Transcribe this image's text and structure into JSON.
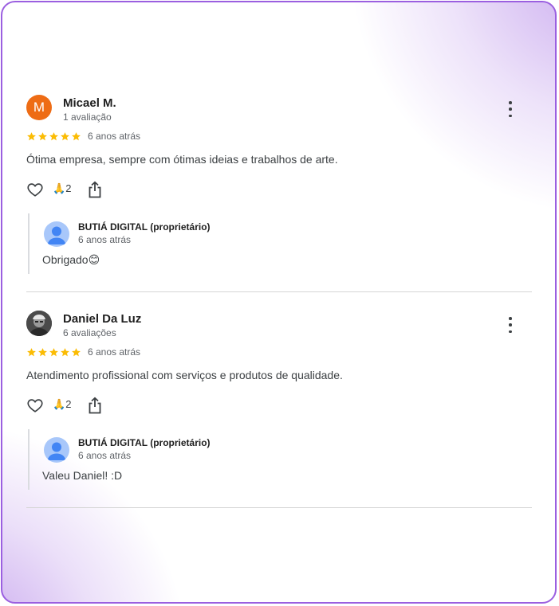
{
  "reviews": [
    {
      "avatar_letter": "M",
      "avatar_color": "#ee6c15",
      "name": "Micael M.",
      "review_count": "1 avaliação",
      "stars": 5,
      "date": "6 anos atrás",
      "text": "Ótima empresa, sempre com ótimas ideias e trabalhos de arte.",
      "reaction_emoji": "🙏",
      "reaction_count": "2",
      "reply": {
        "owner": "BUTIÁ DIGITAL (proprietário)",
        "date": "6 anos atrás",
        "text": "Obrigado😊"
      }
    },
    {
      "avatar_icon": "person-photo-icon",
      "name": "Daniel Da Luz",
      "review_count": "6 avaliações",
      "stars": 5,
      "date": "6 anos atrás",
      "text": "Atendimento profissional com serviços e produtos de qualidade.",
      "reaction_emoji": "🙏",
      "reaction_count": "2",
      "reply": {
        "owner": "BUTIÁ DIGITAL (proprietário)",
        "date": "6 anos atrás",
        "text": "Valeu Daniel! :D"
      }
    }
  ],
  "colors": {
    "star": "#fbbc04",
    "frame_border": "#9b5fe0",
    "owner_avatar": "#a8c7fa",
    "owner_avatar_figure": "#4285f4"
  }
}
